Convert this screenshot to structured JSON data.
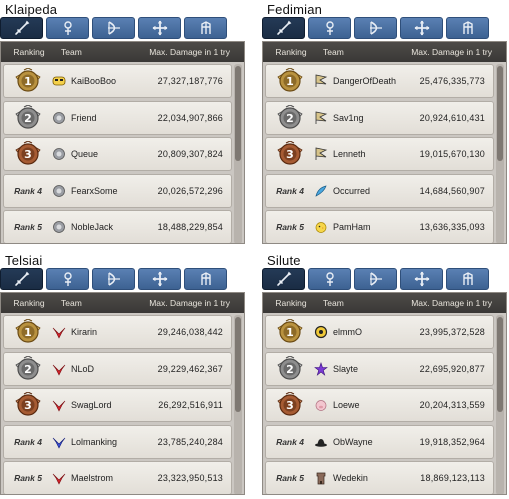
{
  "header": {
    "ranking": "Ranking",
    "team": "Team",
    "damage": "Max. Damage in 1 try"
  },
  "tabs": [
    "sword-icon",
    "staff-icon",
    "bow-icon",
    "cross-icon",
    "fencer-icon"
  ],
  "panels": [
    {
      "title": "Klaipeda",
      "rows": [
        {
          "rank": "1",
          "rank_label": "",
          "team": "KaiBooBoo",
          "damage": "27,327,187,776",
          "icon": "mask-icon"
        },
        {
          "rank": "2",
          "rank_label": "",
          "team": "Friend",
          "damage": "22,034,907,866",
          "icon": "crest-icon"
        },
        {
          "rank": "3",
          "rank_label": "",
          "team": "Queue",
          "damage": "20,809,307,824",
          "icon": "crest-icon"
        },
        {
          "rank": "4",
          "rank_label": "Rank 4",
          "team": "FearxSome",
          "damage": "20,026,572,296",
          "icon": "crest-icon"
        },
        {
          "rank": "5",
          "rank_label": "Rank 5",
          "team": "NobleJack",
          "damage": "18,488,229,854",
          "icon": "crest-icon"
        }
      ]
    },
    {
      "title": "Fedimian",
      "rows": [
        {
          "rank": "1",
          "rank_label": "",
          "team": "DangerOfDeath",
          "damage": "25,476,335,773",
          "icon": "flag-icon"
        },
        {
          "rank": "2",
          "rank_label": "",
          "team": "Sav1ng",
          "damage": "20,924,610,431",
          "icon": "flag-icon"
        },
        {
          "rank": "3",
          "rank_label": "",
          "team": "Lenneth",
          "damage": "19,015,670,130",
          "icon": "flag-icon"
        },
        {
          "rank": "4",
          "rank_label": "Rank 4",
          "team": "Occurred",
          "damage": "14,684,560,907",
          "icon": "feather-icon"
        },
        {
          "rank": "5",
          "rank_label": "Rank 5",
          "team": "PamHam",
          "damage": "13,636,335,093",
          "icon": "chick-icon"
        }
      ]
    },
    {
      "title": "Telsiai",
      "rows": [
        {
          "rank": "1",
          "rank_label": "",
          "team": "Kirarin",
          "damage": "29,246,038,442",
          "icon": "red-emblem-icon"
        },
        {
          "rank": "2",
          "rank_label": "",
          "team": "NLoD",
          "damage": "29,229,462,367",
          "icon": "red-emblem-icon"
        },
        {
          "rank": "3",
          "rank_label": "",
          "team": "SwagLord",
          "damage": "26,292,516,911",
          "icon": "red-emblem-icon"
        },
        {
          "rank": "4",
          "rank_label": "Rank 4",
          "team": "Lolmanking",
          "damage": "23,785,240,284",
          "icon": "blue-emblem-icon"
        },
        {
          "rank": "5",
          "rank_label": "Rank 5",
          "team": "Maelstrom",
          "damage": "23,323,950,513",
          "icon": "red-emblem-icon"
        }
      ]
    },
    {
      "title": "Silute",
      "rows": [
        {
          "rank": "1",
          "rank_label": "",
          "team": "elmmO",
          "damage": "23,995,372,528",
          "icon": "coin-icon"
        },
        {
          "rank": "2",
          "rank_label": "",
          "team": "Slayte",
          "damage": "22,695,920,877",
          "icon": "purple-star-icon"
        },
        {
          "rank": "3",
          "rank_label": "",
          "team": "Loewe",
          "damage": "20,204,313,559",
          "icon": "pig-icon"
        },
        {
          "rank": "4",
          "rank_label": "Rank 4",
          "team": "ObWayne",
          "damage": "19,918,352,964",
          "icon": "hat-icon"
        },
        {
          "rank": "5",
          "rank_label": "Rank 5",
          "team": "Wedekin",
          "damage": "18,869,123,113",
          "icon": "tower-icon"
        }
      ]
    }
  ]
}
